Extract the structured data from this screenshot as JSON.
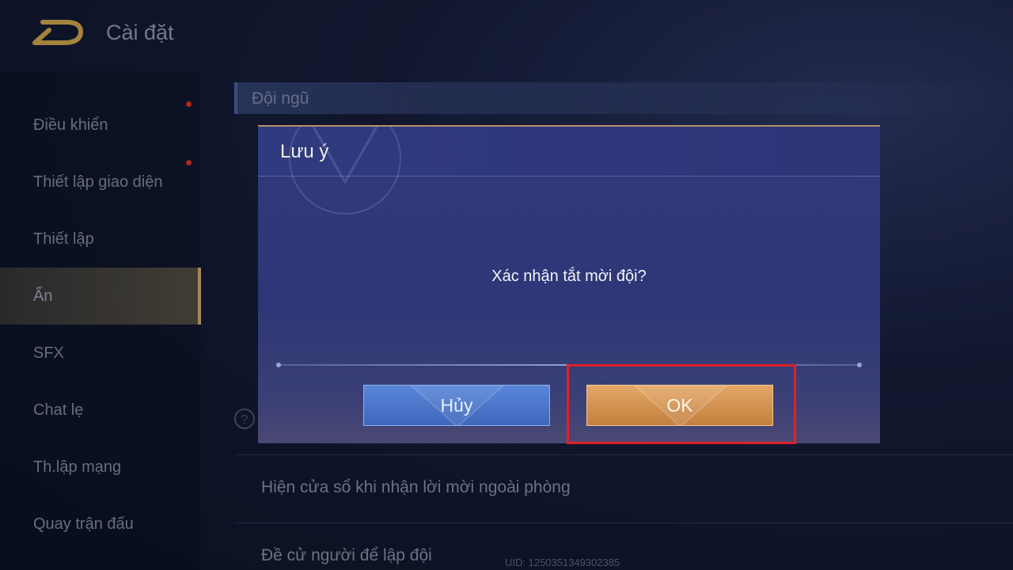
{
  "header": {
    "title": "Cài đặt",
    "back_icon": "back-arrow-icon"
  },
  "sidebar": {
    "items": [
      {
        "label": "Điều khiển",
        "has_badge": true
      },
      {
        "label": "Thiết lập giao diện",
        "has_badge": true
      },
      {
        "label": "Thiết lập",
        "has_badge": false
      },
      {
        "label": "Ẩn",
        "has_badge": false,
        "active": true
      },
      {
        "label": "SFX",
        "has_badge": false
      },
      {
        "label": "Chat lẹ",
        "has_badge": false
      },
      {
        "label": "Th.lập mạng",
        "has_badge": false
      },
      {
        "label": "Quay trận đấu",
        "has_badge": false
      }
    ]
  },
  "main": {
    "section_title": "Đội ngũ",
    "help_icon_label": "?",
    "rows": [
      "Hiện cửa sổ khi nhận lời mời ngoài phòng",
      "Đề cử người để lập đội"
    ],
    "uid": "UID: 1250351349302385"
  },
  "dialog": {
    "title": "Lưu ý",
    "message": "Xác nhận tắt mời đội?",
    "cancel_label": "Hủy",
    "ok_label": "OK"
  },
  "colors": {
    "ok_button": "#d9954f",
    "cancel_button": "#4d78cb",
    "highlight": "#e0202a",
    "badge": "#d2302a"
  }
}
